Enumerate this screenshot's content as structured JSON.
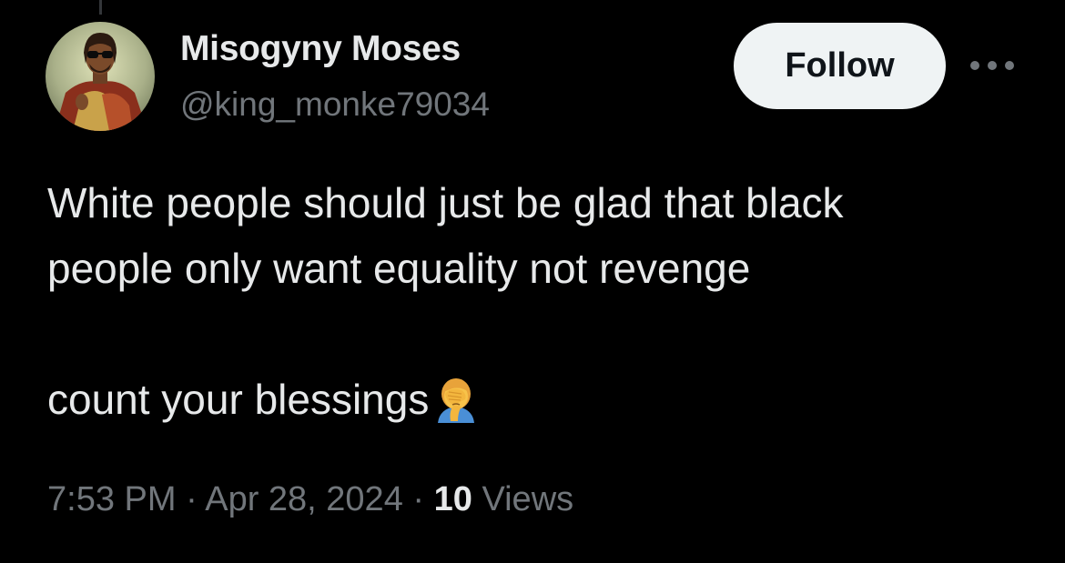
{
  "author": {
    "display_name": "Misogyny Moses",
    "handle": "@king_monke79034",
    "avatar_icon": "profile-photo"
  },
  "actions": {
    "follow_label": "Follow",
    "more_icon": "more-horizontal-icon"
  },
  "tweet": {
    "line1": "White people should just be glad that black",
    "line2": "people only want equality not revenge",
    "line3": "count your blessings",
    "emoji_icon": "facepalm-icon"
  },
  "meta": {
    "time": "7:53 PM",
    "separator": "·",
    "date": "Apr 28, 2024",
    "views_count": "10",
    "views_label": "Views"
  },
  "colors": {
    "background": "#000000",
    "primary_text": "#e7e9ea",
    "secondary_text": "#71767b",
    "follow_bg": "#eff3f4"
  }
}
